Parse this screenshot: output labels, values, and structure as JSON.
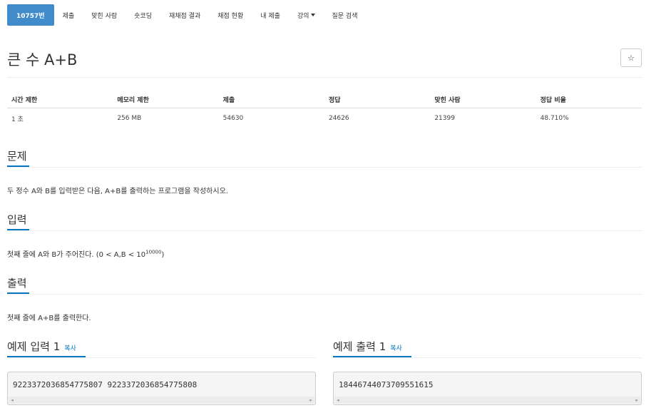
{
  "tabs": [
    {
      "label": "10757번",
      "active": true
    },
    {
      "label": "제출"
    },
    {
      "label": "맞힌 사람"
    },
    {
      "label": "숏코딩"
    },
    {
      "label": "재채점 결과"
    },
    {
      "label": "채점 현황"
    },
    {
      "label": "내 제출"
    },
    {
      "label": "강의"
    },
    {
      "label": "질문 검색"
    }
  ],
  "problem": {
    "title": "큰 수 A+B",
    "star_icon": "☆"
  },
  "stats": {
    "headers": [
      "시간 제한",
      "메모리 제한",
      "제출",
      "정답",
      "맞힌 사람",
      "정답 비율"
    ],
    "values": [
      "1 초",
      "256 MB",
      "54630",
      "24626",
      "21399",
      "48.710%"
    ]
  },
  "sections": {
    "description": {
      "title": "문제",
      "text": "두 정수 A와 B를 입력받은 다음, A+B를 출력하는 프로그램을 작성하시오."
    },
    "input": {
      "title": "입력",
      "text_prefix": "첫째 줄에 A와 B가 주어진다. (0 < A,B < 10",
      "exponent": "10000",
      "text_suffix": ")"
    },
    "output": {
      "title": "출력",
      "text": "첫째 줄에 A+B를 출력한다."
    }
  },
  "samples": {
    "input": {
      "title": "예제 입력 1",
      "copy": "복사",
      "value": "9223372036854775807 9223372036854775808"
    },
    "output": {
      "title": "예제 출력 1",
      "copy": "복사",
      "value": "18446744073709551615"
    }
  },
  "colors": {
    "accent": "#428bca",
    "link": "#0076c0"
  }
}
